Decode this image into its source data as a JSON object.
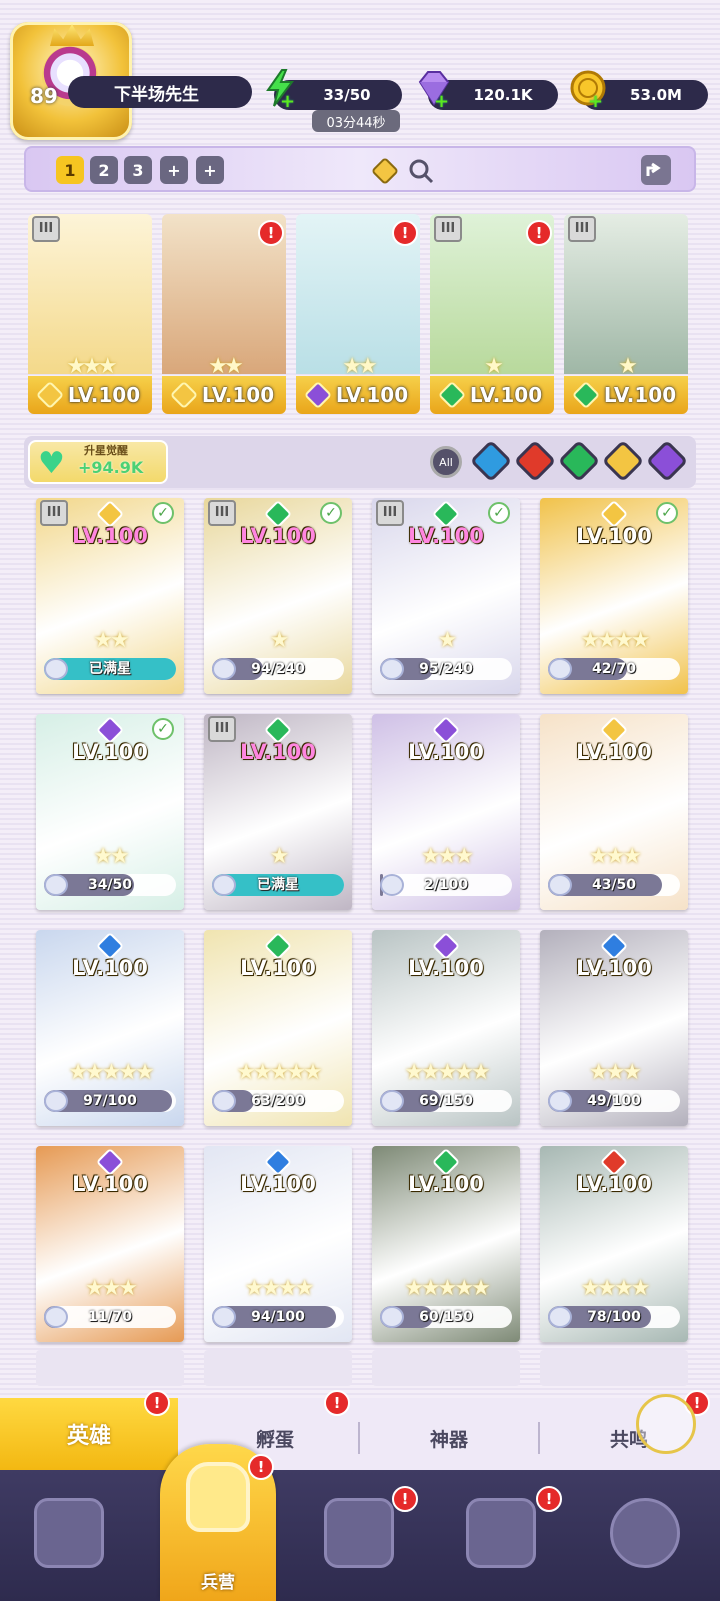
{
  "player": {
    "level": "89",
    "name": "下半场先生"
  },
  "resources": {
    "stamina": "33/50",
    "stamina_timer": "03分44秒",
    "gems": "120.1K",
    "gold": "53.0M"
  },
  "team_tabs": [
    "1",
    "2",
    "3",
    "+",
    "+"
  ],
  "lineup": [
    {
      "level": "LV.100",
      "stars": "★★★",
      "element": "light",
      "color": "#f3c542"
    },
    {
      "level": "LV.100",
      "stars": "★★",
      "element": "light",
      "color": "#f3c542"
    },
    {
      "level": "LV.100",
      "stars": "★★",
      "element": "dark",
      "color": "#8b4fd8"
    },
    {
      "level": "LV.100",
      "stars": "★",
      "element": "wind",
      "color": "#29b85a"
    },
    {
      "level": "LV.100",
      "stars": "★",
      "element": "wind",
      "color": "#29b85a"
    }
  ],
  "awaken": {
    "title": "升星觉醒",
    "value": "+94.9K"
  },
  "filters": [
    "All"
  ],
  "heroes": [
    {
      "level": "LV.100",
      "progress": "已满星",
      "ratio": 1.0,
      "stars": "★★",
      "element_color": "#f3c542",
      "bg": "#f2d78a",
      "pink": true,
      "check": true,
      "maxed": true
    },
    {
      "level": "LV.100",
      "progress": "94/240",
      "ratio": 0.39,
      "stars": "★",
      "element_color": "#29b85a",
      "bg": "#e8d79b",
      "pink": true,
      "check": true,
      "maxed": false
    },
    {
      "level": "LV.100",
      "progress": "95/240",
      "ratio": 0.4,
      "stars": "★",
      "element_color": "#29b85a",
      "bg": "#d9d7ec",
      "pink": true,
      "check": true,
      "maxed": false
    },
    {
      "level": "LV.100",
      "progress": "42/70",
      "ratio": 0.6,
      "stars": "★★★★",
      "element_color": "#f3c542",
      "bg": "#f1c24a",
      "pink": false,
      "check": true,
      "maxed": false
    },
    {
      "level": "LV.100",
      "progress": "34/50",
      "ratio": 0.68,
      "stars": "★★",
      "element_color": "#8b4fd8",
      "bg": "#d6efe6",
      "pink": false,
      "check": true,
      "maxed": false
    },
    {
      "level": "LV.100",
      "progress": "已满星",
      "ratio": 1.0,
      "stars": "★",
      "element_color": "#29b85a",
      "bg": "#bfb6c4",
      "pink": true,
      "check": false,
      "maxed": true
    },
    {
      "level": "LV.100",
      "progress": "2/100",
      "ratio": 0.02,
      "stars": "★★★",
      "element_color": "#8b4fd8",
      "bg": "#cfc0e6",
      "pink": false,
      "check": false,
      "maxed": false
    },
    {
      "level": "LV.100",
      "progress": "43/50",
      "ratio": 0.86,
      "stars": "★★★",
      "element_color": "#f3c542",
      "bg": "#f6e2c8",
      "pink": false,
      "check": false,
      "maxed": false
    },
    {
      "level": "LV.100",
      "progress": "97/100",
      "ratio": 0.97,
      "stars": "★★★★★",
      "element_color": "#2f7ee0",
      "bg": "#c9d7ee",
      "pink": false,
      "check": false,
      "maxed": false
    },
    {
      "level": "LV.100",
      "progress": "63/200",
      "ratio": 0.315,
      "stars": "★★★★★",
      "element_color": "#29b85a",
      "bg": "#f0e4b0",
      "pink": false,
      "check": false,
      "maxed": false
    },
    {
      "level": "LV.100",
      "progress": "69/150",
      "ratio": 0.46,
      "stars": "★★★★★",
      "element_color": "#8b4fd8",
      "bg": "#b9c4c4",
      "pink": false,
      "check": false,
      "maxed": false
    },
    {
      "level": "LV.100",
      "progress": "49/100",
      "ratio": 0.49,
      "stars": "★★★",
      "element_color": "#2f7ee0",
      "bg": "#b3b0bc",
      "pink": false,
      "check": false,
      "maxed": false
    },
    {
      "level": "LV.100",
      "progress": "11/70",
      "ratio": 0.157,
      "stars": "★★★",
      "element_color": "#8b4fd8",
      "bg": "#e69a54",
      "pink": false,
      "check": false,
      "maxed": false
    },
    {
      "level": "LV.100",
      "progress": "94/100",
      "ratio": 0.94,
      "stars": "★★★★",
      "element_color": "#2f7ee0",
      "bg": "#e2e6f3",
      "pink": false,
      "check": false,
      "maxed": false
    },
    {
      "level": "LV.100",
      "progress": "60/150",
      "ratio": 0.4,
      "stars": "★★★★★",
      "element_color": "#29b85a",
      "bg": "#7e8a76",
      "pink": false,
      "check": false,
      "maxed": false
    },
    {
      "level": "LV.100",
      "progress": "78/100",
      "ratio": 0.78,
      "stars": "★★★★",
      "element_color": "#e03a2a",
      "bg": "#a7b8b3",
      "pink": false,
      "check": false,
      "maxed": false
    }
  ],
  "subtabs": [
    "英雄",
    "孵蛋",
    "神器",
    "共鸣"
  ],
  "nav": {
    "active_label": "兵营"
  },
  "badge": "!",
  "colors": {
    "accent_gold": "#f6c521",
    "dark_panel": "#2d2a4a",
    "notification_red": "#e52a2a"
  }
}
